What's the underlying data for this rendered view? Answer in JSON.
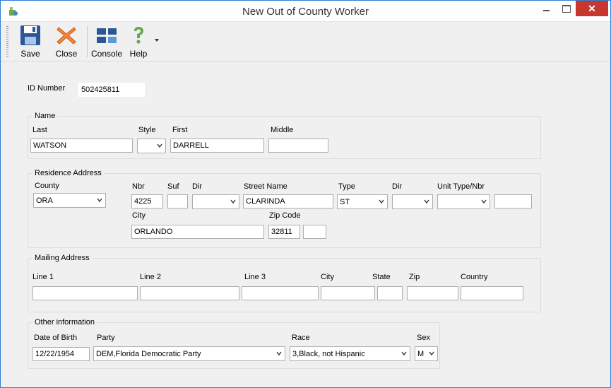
{
  "window": {
    "title": "New Out of County Worker"
  },
  "toolbar": {
    "save_label": "Save",
    "close_label": "Close",
    "console_label": "Console",
    "help_label": "Help"
  },
  "id": {
    "label": "ID Number",
    "value": "502425811"
  },
  "name": {
    "title": "Name",
    "last_label": "Last",
    "last_value": "WATSON",
    "style_label": "Style",
    "style_value": "",
    "first_label": "First",
    "first_value": "DARRELL",
    "middle_label": "Middle",
    "middle_value": ""
  },
  "residence": {
    "title": "Residence Address",
    "county_label": "County",
    "county_value": "ORA",
    "nbr_label": "Nbr",
    "nbr_value": "4225",
    "suf_label": "Suf",
    "suf_value": "",
    "dir_label": "Dir",
    "dir_value": "",
    "street_label": "Street Name",
    "street_value": "CLARINDA",
    "type_label": "Type",
    "type_value": "ST",
    "dir2_label": "Dir",
    "dir2_value": "",
    "unit_label": "Unit Type/Nbr",
    "unit_type_value": "",
    "unit_nbr_value": "",
    "city_label": "City",
    "city_value": "ORLANDO",
    "zip_label": "Zip Code",
    "zip_value": "32811",
    "zip4_value": ""
  },
  "mailing": {
    "title": "Mailing Address",
    "line1_label": "Line 1",
    "line2_label": "Line 2",
    "line3_label": "Line 3",
    "city_label": "City",
    "state_label": "State",
    "zip_label": "Zip",
    "country_label": "Country"
  },
  "other": {
    "title": "Other information",
    "dob_label": "Date of Birth",
    "dob_value": "12/22/1954",
    "party_label": "Party",
    "party_value": "DEM,Florida Democratic Party",
    "race_label": "Race",
    "race_value": "3,Black, not Hispanic",
    "sex_label": "Sex",
    "sex_value": "M"
  }
}
